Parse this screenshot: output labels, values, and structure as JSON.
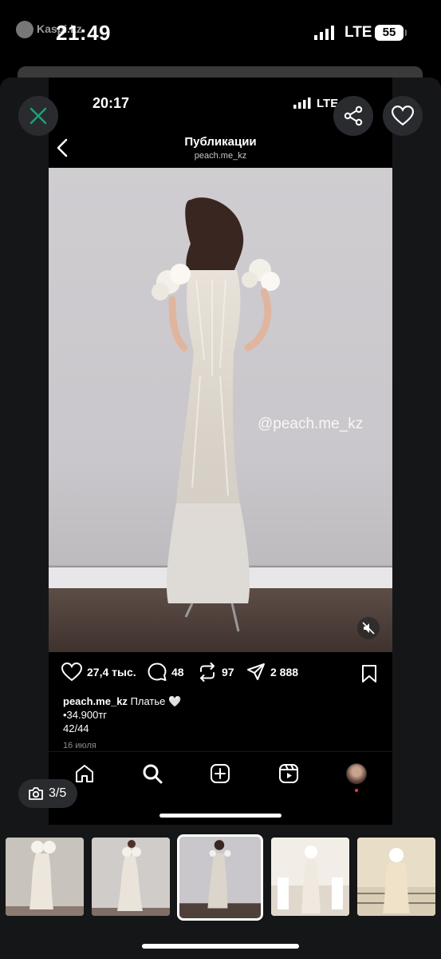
{
  "outer_status": {
    "app_name": "Kaspi.kz",
    "time": "21:49",
    "network": "LTE",
    "battery": "55"
  },
  "inner_status": {
    "time": "20:17",
    "network": "LTE"
  },
  "header": {
    "title": "Публикации",
    "username": "peach.me_kz"
  },
  "photo": {
    "watermark": "@peach.me_kz"
  },
  "actions": {
    "likes": "27,4 тыс.",
    "comments": "48",
    "reposts": "97",
    "shares": "2 888"
  },
  "caption": {
    "username": "peach.me_kz",
    "text": "Платье 🤍",
    "price": "•34.900тг",
    "sizes": "42/44",
    "date": "16 июля"
  },
  "viewer": {
    "counter": "3/5"
  },
  "colors": {
    "background": "#000000",
    "sheet": "#151618",
    "button": "#2a2b2e",
    "notification_dot": "#ff3040"
  },
  "icons": [
    "close-icon",
    "share-icon",
    "heart-icon",
    "back-icon",
    "mute-icon",
    "comment-icon",
    "repost-icon",
    "send-icon",
    "bookmark-icon",
    "home-icon",
    "search-icon",
    "add-icon",
    "reels-icon",
    "camera-icon"
  ]
}
